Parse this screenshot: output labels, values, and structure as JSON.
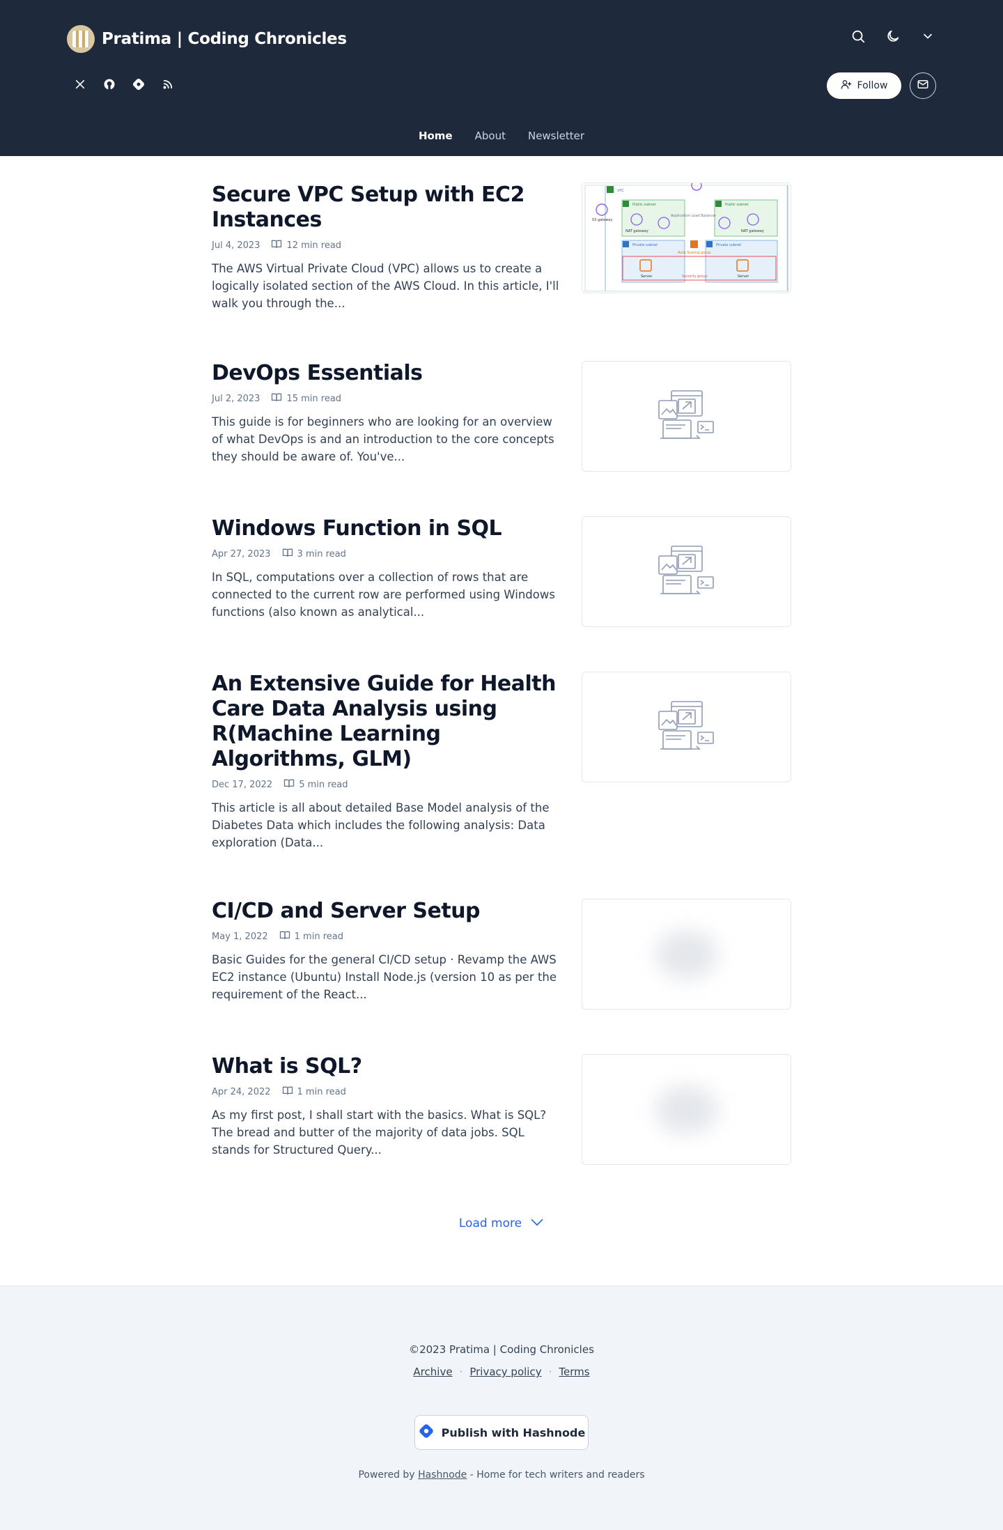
{
  "header": {
    "blog_title": "Pratima | Coding Chronicles",
    "follow_label": "Follow",
    "socials": [
      "x-icon",
      "github-icon",
      "hashnode-icon",
      "rss-icon"
    ],
    "icons": [
      "search-icon",
      "moon-icon",
      "chevron-down-icon"
    ]
  },
  "nav": {
    "items": [
      {
        "label": "Home",
        "active": true
      },
      {
        "label": "About",
        "active": false
      },
      {
        "label": "Newsletter",
        "active": false
      }
    ]
  },
  "posts": [
    {
      "title": "Secure VPC Setup with EC2 Instances",
      "date": "Jul 4, 2023",
      "read_time": "12 min read",
      "excerpt": "The AWS Virtual Private Cloud (VPC) allows us to create a logically isolated section of the AWS Cloud. In this article, I'll walk you through the...",
      "thumb_type": "vpc-diagram",
      "diagram_labels": {
        "vpc": "VPC",
        "igw": "S3 gateway",
        "public_subnet": "Public subnet",
        "alb": "Application Load Balancer",
        "nat": "NAT gateway",
        "private_subnet": "Private subnet",
        "asg": "Auto Scaling group",
        "ec2": "Server",
        "sg": "Security group"
      }
    },
    {
      "title": "DevOps Essentials",
      "date": "Jul 2, 2023",
      "read_time": "15 min read",
      "excerpt": "This guide is for beginners who are looking for an overview of what DevOps is and an introduction to the core concepts they should be aware of. You've...",
      "thumb_type": "placeholder"
    },
    {
      "title": "Windows Function in SQL",
      "date": "Apr 27, 2023",
      "read_time": "3 min read",
      "excerpt": "In SQL, computations over a collection of rows that are connected to the current row are performed using Windows functions (also known as analytical...",
      "thumb_type": "placeholder"
    },
    {
      "title": "An Extensive Guide for Health Care Data Analysis using R(Machine Learning Algorithms, GLM)",
      "date": "Dec 17, 2022",
      "read_time": "5 min read",
      "excerpt": "This article is all about detailed Base Model analysis of the Diabetes Data which includes the following analysis: Data exploration (Data...",
      "thumb_type": "placeholder"
    },
    {
      "title": "CI/CD and Server Setup",
      "date": "May 1, 2022",
      "read_time": "1 min read",
      "excerpt": "Basic Guides for the general CI/CD setup · Revamp the AWS EC2 instance (Ubuntu) Install Node.js (version 10 as per the requirement of the React...",
      "thumb_type": "blur"
    },
    {
      "title": "What is SQL?",
      "date": "Apr 24, 2022",
      "read_time": "1 min read",
      "excerpt": "As my first post, I shall start with the basics. What is SQL? The bread and butter of the majority of data jobs. SQL stands for Structured Query...",
      "thumb_type": "blur"
    }
  ],
  "load_more": "Load more",
  "footer": {
    "copyright": "©2023 Pratima | Coding Chronicles",
    "links": [
      "Archive",
      "Privacy policy",
      "Terms"
    ],
    "publish_label": "Publish with Hashnode",
    "powered_prefix": "Powered by",
    "powered_link": "Hashnode",
    "powered_suffix": "- Home for tech writers and readers"
  },
  "colors": {
    "header_bg": "#1e293b",
    "accent": "#2563eb",
    "footer_bg": "#f1f5f9"
  }
}
